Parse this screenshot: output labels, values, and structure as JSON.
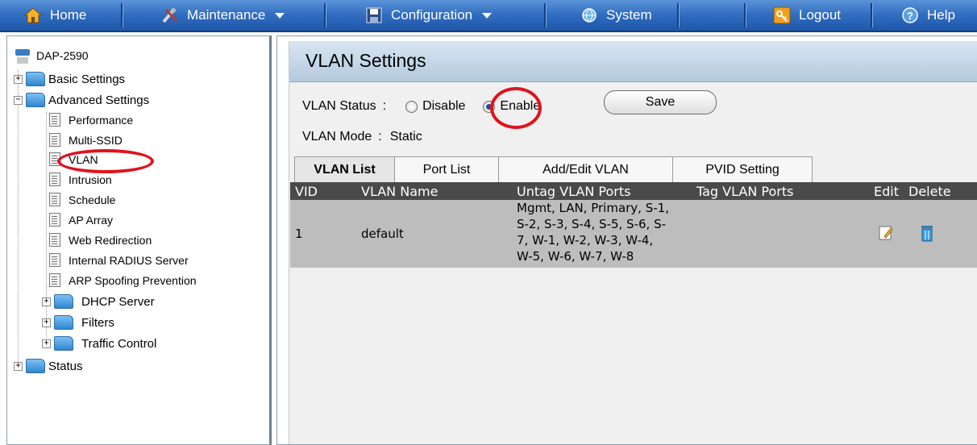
{
  "nav": {
    "home": "Home",
    "maintenance": "Maintenance",
    "configuration": "Configuration",
    "system": "System",
    "logout": "Logout",
    "help": "Help"
  },
  "tree": {
    "device": "DAP-2590",
    "basic_settings": "Basic Settings",
    "advanced_settings": "Advanced Settings",
    "items": [
      "Performance",
      "Multi-SSID",
      "VLAN",
      "Intrusion",
      "Schedule",
      "AP Array",
      "Web Redirection",
      "Internal RADIUS Server",
      "ARP Spoofing Prevention"
    ],
    "folders": [
      "DHCP Server",
      "Filters",
      "Traffic Control"
    ],
    "status": "Status"
  },
  "page": {
    "title": "VLAN Settings",
    "vlan_status_label": "VLAN Status",
    "sep": ":",
    "disable": "Disable",
    "enable": "Enable",
    "selected": "Enable",
    "save": "Save",
    "vlan_mode_label": "VLAN Mode",
    "vlan_mode_value": "Static"
  },
  "tabs": [
    "VLAN List",
    "Port List",
    "Add/Edit VLAN",
    "PVID Setting"
  ],
  "active_tab": "VLAN List",
  "table": {
    "headers": [
      "VID",
      "VLAN Name",
      "Untag VLAN Ports",
      "Tag VLAN Ports",
      "Edit",
      "Delete"
    ],
    "rows": [
      {
        "vid": "1",
        "name": "default",
        "untag_lines": [
          "Mgmt, LAN, Primary, S-1,",
          "S-2, S-3, S-4, S-5, S-6, S-",
          "7, W-1, W-2, W-3, W-4,",
          "W-5, W-6, W-7, W-8"
        ],
        "tag": ""
      }
    ]
  },
  "colors": {
    "nav_blue": "#2f6cc0",
    "annotation_red": "#e0131c",
    "table_header": "#4a4a4a",
    "row_bg": "#bdbdbd"
  }
}
